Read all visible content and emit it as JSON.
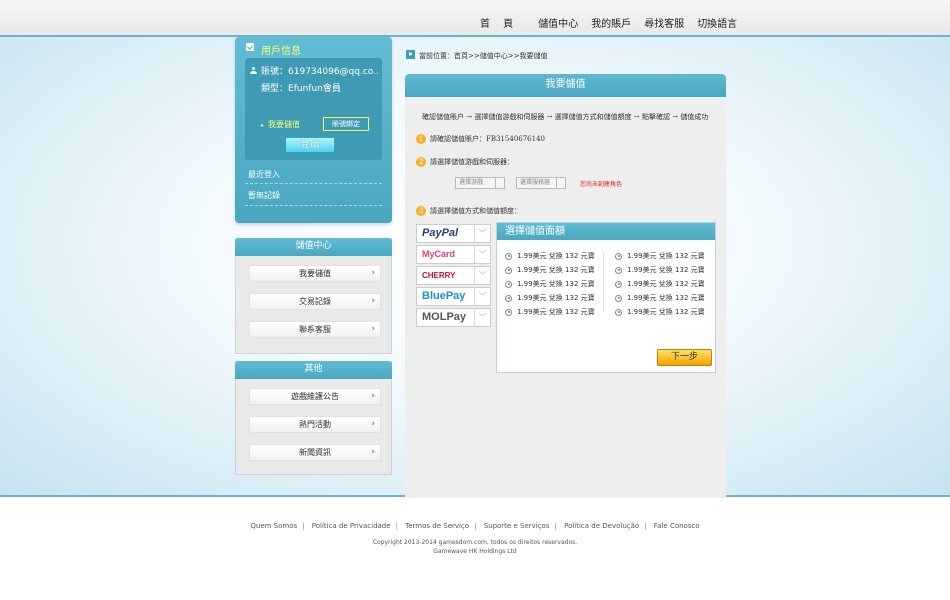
{
  "topnav": {
    "items": [
      "首 頁",
      "儲值中心",
      "我的賬戶",
      "尋找客服",
      "切換語言"
    ]
  },
  "user_panel": {
    "title": "用戶信息",
    "account_label": "賬號：",
    "account_value": "619734096@qq.co..",
    "type_label": "類型：",
    "type_value": "Efunfun會員",
    "recharge_link": "我要儲值",
    "bind_button": "賬號綁定",
    "logout_button": "登出",
    "recent_login": "最近登入",
    "no_record": "暫無記錄"
  },
  "recharge_panel": {
    "title": "儲值中心",
    "items": [
      "我要儲值",
      "交易記錄",
      "聯系客服"
    ]
  },
  "other_panel": {
    "title": "其他",
    "items": [
      "遊戲維護公告",
      "熱門活動",
      "新聞資訊"
    ]
  },
  "breadcrumb": "當前位置：首頁>>儲值中心>>我要儲值",
  "main": {
    "title": "我要儲值",
    "flow": "確認儲值賬户 → 選擇儲值游戲和伺服器 → 選擇儲值方式和儲值額度 → 點擊確認 → 儲值成功",
    "step1_label": "請確認儲值賬户：",
    "step1_value": "FB31540676140",
    "step2_label": "請選擇儲值游戲和伺服器：",
    "game_select_placeholder": "選擇游戲",
    "server_select_placeholder": "選擇服務器",
    "no_role_warning": "您尚未創建角色",
    "step3_label": "請選擇儲值方式和儲值額度：",
    "payment_methods": [
      "PayPal",
      "MyCard",
      "CHERRY",
      "BluePay",
      "MOLPay"
    ],
    "amount_title": "選擇儲值面額",
    "amount_options_left": [
      "1.99美元 兌換 132 元寶",
      "1.99美元 兌換 132 元寶",
      "1.99美元 兌換 132 元寶",
      "1.99美元 兌換 132 元寶",
      "1.99美元 兌換 132 元寶"
    ],
    "amount_options_right": [
      "1.99美元 兌換 132 元寶",
      "1.99美元 兌換 132 元寶",
      "1.99美元 兌換 132 元寶",
      "1.99美元 兌換 132 元寶",
      "1.99美元 兌換 132 元寶"
    ],
    "next_button": "下一步"
  },
  "footer": {
    "links": [
      "Quem Somos",
      "Política de Privacidade",
      "Termos de Serviço",
      "Suporte e Serviços",
      "Política de Devolução",
      "Fale Conosco"
    ],
    "copyright": "Copyright 2013-2014 gamesdom.com, todos os direitos reservados.",
    "company": "Gamewave HK Holdings Ltd"
  },
  "colors": {
    "accent_blue": "#4aa7c0",
    "highlight_yellow": "#f6ff7a",
    "warning_red": "#e0241b",
    "next_button": "#f6a400",
    "paypal": "#253b80",
    "bluepay": "#1b8fd8"
  }
}
